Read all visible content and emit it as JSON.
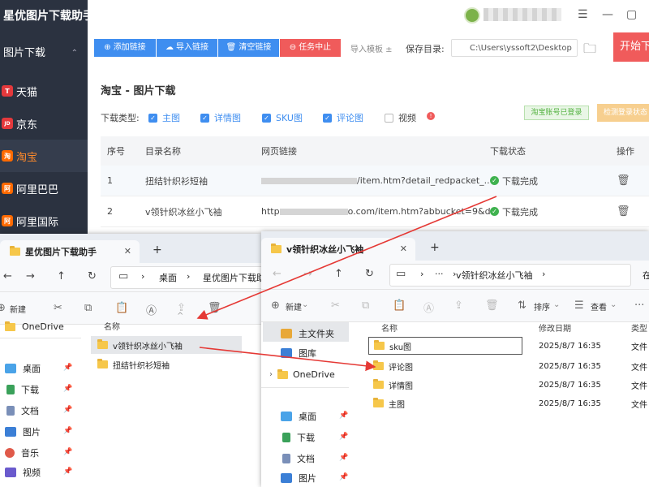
{
  "app": {
    "title": "星优图片下载助手",
    "group_label": "图片下载",
    "platforms": [
      {
        "label": "天猫",
        "icon": "tmall-icon",
        "color": "#e4393c",
        "glyph": "T"
      },
      {
        "label": "京东",
        "icon": "jd-icon",
        "color": "#e4393c",
        "glyph": "JD"
      },
      {
        "label": "淘宝",
        "icon": "taobao-icon",
        "color": "#ff6a00",
        "glyph": "淘"
      },
      {
        "label": "阿里巴巴",
        "icon": "alibaba-icon",
        "color": "#ff6a00",
        "glyph": "阿"
      },
      {
        "label": "阿里国际",
        "icon": "alibaba-intl-icon",
        "color": "#ff6a00",
        "glyph": "阿"
      }
    ],
    "active_platform": "淘宝",
    "toolbar": {
      "add_link": "添加链接",
      "import_link": "导入链接",
      "clear_link": "清空链接",
      "stop_task": "任务中止",
      "import_template": "导入模板 ±",
      "save_dir_label": "保存目录:",
      "save_dir_value": "C:\\Users\\yssoft2\\Desktop",
      "start": "开始下载"
    },
    "section_title": "淘宝 - 图片下载",
    "download_type_label": "下载类型:",
    "download_types": [
      {
        "label": "主图",
        "checked": true
      },
      {
        "label": "详情图",
        "checked": true
      },
      {
        "label": "SKU图",
        "checked": true
      },
      {
        "label": "评论图",
        "checked": true
      },
      {
        "label": "视频",
        "checked": false
      }
    ],
    "login_status": "淘宝账号已登录",
    "check_login": "检测登录状态",
    "table": {
      "headers": [
        "序号",
        "目录名称",
        "网页链接",
        "下载状态",
        "操作"
      ],
      "rows": [
        {
          "no": "1",
          "name": "扭结针织衫短袖",
          "url": "/item.htm?detail_redpacket_...",
          "status": "下载完成"
        },
        {
          "no": "2",
          "name": "v领针织冰丝小飞袖",
          "url_prefix": "http",
          "url": "o.com/item.htm?abbucket=9&det...",
          "status": "下载完成"
        }
      ]
    },
    "colors": {
      "primary": "#3f8ef0",
      "danger": "#f05b5b",
      "success": "#3fb24f",
      "sidebar": "#2b3240"
    }
  },
  "explorer_left": {
    "tab_title": "星优图片下载助手",
    "breadcrumb": [
      "桌面",
      "星优图片下载助"
    ],
    "cmd_new": "新建",
    "nav_items": [
      {
        "label": "OneDrive",
        "icon": "onedrive-folder-icon"
      },
      {
        "label": "桌面",
        "icon": "desktop-icon"
      },
      {
        "label": "下载",
        "icon": "download-icon"
      },
      {
        "label": "文档",
        "icon": "documents-icon"
      },
      {
        "label": "图片",
        "icon": "pictures-icon"
      },
      {
        "label": "音乐",
        "icon": "music-icon"
      },
      {
        "label": "视频",
        "icon": "videos-icon"
      }
    ],
    "column_name": "名称",
    "files": [
      "v领针织冰丝小飞袖",
      "扭结针织衫短袖"
    ]
  },
  "explorer_right": {
    "tab_title": "v领针织冰丝小飞袖",
    "breadcrumb": [
      "v领针织冰丝小飞袖"
    ],
    "cmd_new": "新建",
    "cmd_sort": "排序",
    "cmd_view": "查看",
    "nav_items": [
      {
        "label": "主文件夹",
        "icon": "home-icon"
      },
      {
        "label": "图库",
        "icon": "gallery-icon"
      },
      {
        "label": "OneDrive",
        "icon": "onedrive-folder-icon"
      },
      {
        "label": "桌面",
        "icon": "desktop-icon"
      },
      {
        "label": "下载",
        "icon": "download-icon"
      },
      {
        "label": "文档",
        "icon": "documents-icon"
      },
      {
        "label": "图片",
        "icon": "pictures-icon"
      }
    ],
    "columns": [
      "名称",
      "修改日期",
      "类型"
    ],
    "files": [
      {
        "name": "sku图",
        "date": "2025/8/7 16:35",
        "type": "文件"
      },
      {
        "name": "评论图",
        "date": "2025/8/7 16:35",
        "type": "文件"
      },
      {
        "name": "详情图",
        "date": "2025/8/7 16:35",
        "type": "文件"
      },
      {
        "name": "主图",
        "date": "2025/8/7 16:35",
        "type": "文件"
      }
    ]
  }
}
